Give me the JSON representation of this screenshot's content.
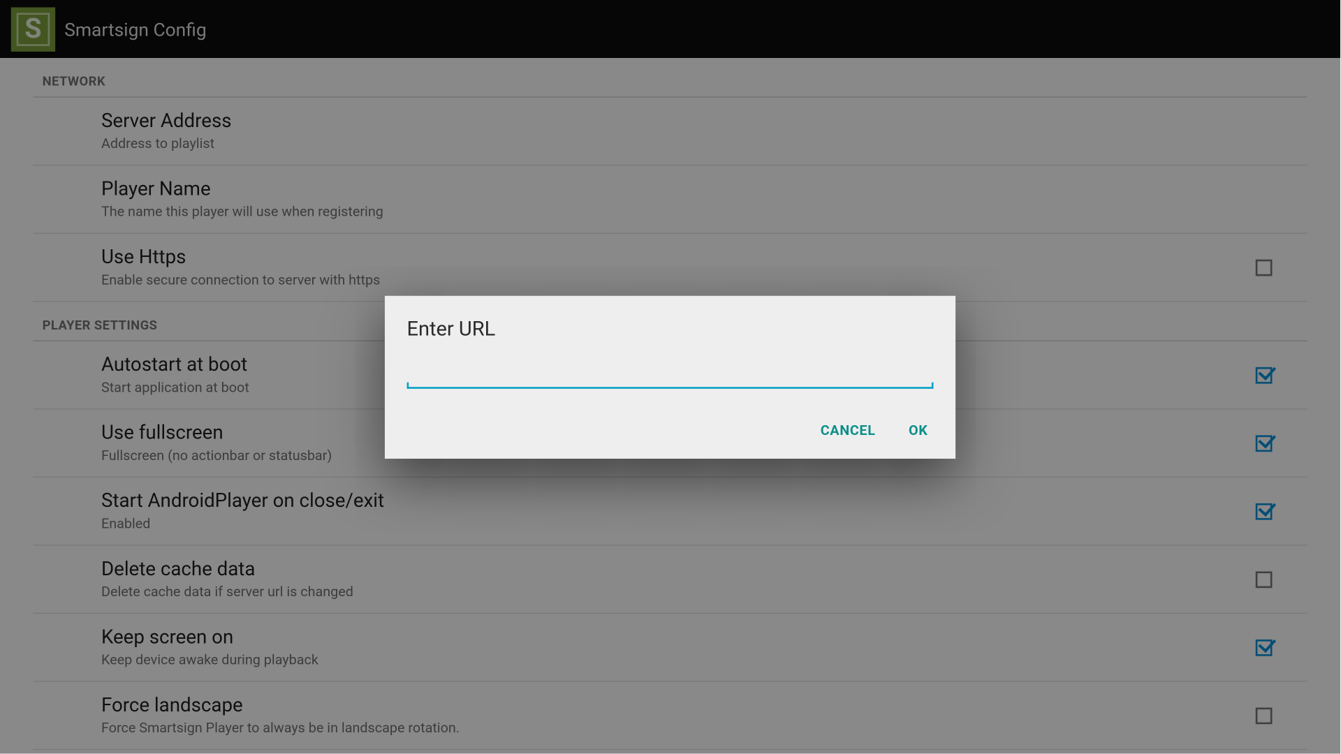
{
  "app": {
    "title": "Smartsign Config",
    "icon_letter": "S"
  },
  "sections": {
    "network": {
      "header": "NETWORK",
      "server_address": {
        "title": "Server Address",
        "sub": "Address to playlist"
      },
      "player_name": {
        "title": "Player Name",
        "sub": "The name this player will use when registering"
      },
      "use_https": {
        "title": "Use Https",
        "sub": "Enable secure connection to server with https",
        "checked": false
      }
    },
    "player": {
      "header": "PLAYER SETTINGS",
      "autostart": {
        "title": "Autostart at boot",
        "sub": "Start application at boot",
        "checked": true
      },
      "fullscreen": {
        "title": "Use fullscreen",
        "sub": "Fullscreen (no actionbar or statusbar)",
        "checked": true
      },
      "restart_on_close": {
        "title": "Start AndroidPlayer on close/exit",
        "sub": "Enabled",
        "checked": true
      },
      "delete_cache": {
        "title": "Delete cache data",
        "sub": "Delete cache data if server url is changed",
        "checked": false
      },
      "keep_screen_on": {
        "title": "Keep screen on",
        "sub": "Keep device awake during playback",
        "checked": true
      },
      "force_landscape": {
        "title": "Force landscape",
        "sub": "Force Smartsign Player to always be in landscape rotation.",
        "checked": false
      }
    }
  },
  "dialog": {
    "title": "Enter URL",
    "value": "",
    "cancel": "CANCEL",
    "ok": "OK"
  }
}
